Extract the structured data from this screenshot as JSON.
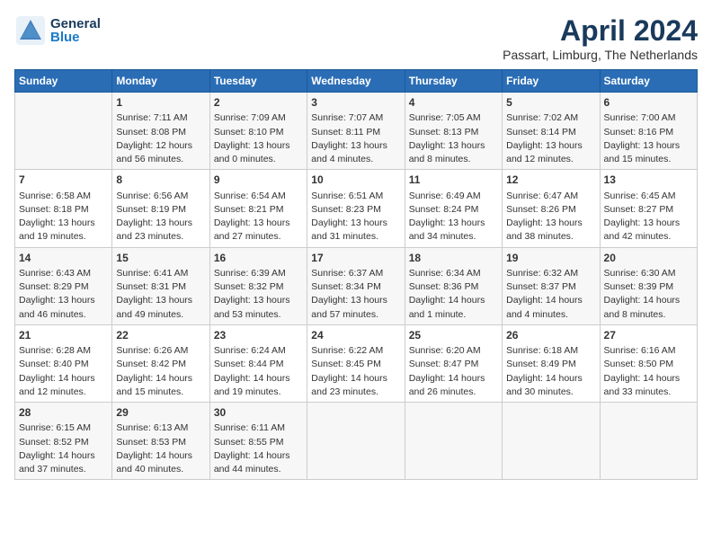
{
  "header": {
    "logo_general": "General",
    "logo_blue": "Blue",
    "month_year": "April 2024",
    "location": "Passart, Limburg, The Netherlands"
  },
  "days_of_week": [
    "Sunday",
    "Monday",
    "Tuesday",
    "Wednesday",
    "Thursday",
    "Friday",
    "Saturday"
  ],
  "weeks": [
    [
      {
        "day": "",
        "info": ""
      },
      {
        "day": "1",
        "info": "Sunrise: 7:11 AM\nSunset: 8:08 PM\nDaylight: 12 hours\nand 56 minutes."
      },
      {
        "day": "2",
        "info": "Sunrise: 7:09 AM\nSunset: 8:10 PM\nDaylight: 13 hours\nand 0 minutes."
      },
      {
        "day": "3",
        "info": "Sunrise: 7:07 AM\nSunset: 8:11 PM\nDaylight: 13 hours\nand 4 minutes."
      },
      {
        "day": "4",
        "info": "Sunrise: 7:05 AM\nSunset: 8:13 PM\nDaylight: 13 hours\nand 8 minutes."
      },
      {
        "day": "5",
        "info": "Sunrise: 7:02 AM\nSunset: 8:14 PM\nDaylight: 13 hours\nand 12 minutes."
      },
      {
        "day": "6",
        "info": "Sunrise: 7:00 AM\nSunset: 8:16 PM\nDaylight: 13 hours\nand 15 minutes."
      }
    ],
    [
      {
        "day": "7",
        "info": "Sunrise: 6:58 AM\nSunset: 8:18 PM\nDaylight: 13 hours\nand 19 minutes."
      },
      {
        "day": "8",
        "info": "Sunrise: 6:56 AM\nSunset: 8:19 PM\nDaylight: 13 hours\nand 23 minutes."
      },
      {
        "day": "9",
        "info": "Sunrise: 6:54 AM\nSunset: 8:21 PM\nDaylight: 13 hours\nand 27 minutes."
      },
      {
        "day": "10",
        "info": "Sunrise: 6:51 AM\nSunset: 8:23 PM\nDaylight: 13 hours\nand 31 minutes."
      },
      {
        "day": "11",
        "info": "Sunrise: 6:49 AM\nSunset: 8:24 PM\nDaylight: 13 hours\nand 34 minutes."
      },
      {
        "day": "12",
        "info": "Sunrise: 6:47 AM\nSunset: 8:26 PM\nDaylight: 13 hours\nand 38 minutes."
      },
      {
        "day": "13",
        "info": "Sunrise: 6:45 AM\nSunset: 8:27 PM\nDaylight: 13 hours\nand 42 minutes."
      }
    ],
    [
      {
        "day": "14",
        "info": "Sunrise: 6:43 AM\nSunset: 8:29 PM\nDaylight: 13 hours\nand 46 minutes."
      },
      {
        "day": "15",
        "info": "Sunrise: 6:41 AM\nSunset: 8:31 PM\nDaylight: 13 hours\nand 49 minutes."
      },
      {
        "day": "16",
        "info": "Sunrise: 6:39 AM\nSunset: 8:32 PM\nDaylight: 13 hours\nand 53 minutes."
      },
      {
        "day": "17",
        "info": "Sunrise: 6:37 AM\nSunset: 8:34 PM\nDaylight: 13 hours\nand 57 minutes."
      },
      {
        "day": "18",
        "info": "Sunrise: 6:34 AM\nSunset: 8:36 PM\nDaylight: 14 hours\nand 1 minute."
      },
      {
        "day": "19",
        "info": "Sunrise: 6:32 AM\nSunset: 8:37 PM\nDaylight: 14 hours\nand 4 minutes."
      },
      {
        "day": "20",
        "info": "Sunrise: 6:30 AM\nSunset: 8:39 PM\nDaylight: 14 hours\nand 8 minutes."
      }
    ],
    [
      {
        "day": "21",
        "info": "Sunrise: 6:28 AM\nSunset: 8:40 PM\nDaylight: 14 hours\nand 12 minutes."
      },
      {
        "day": "22",
        "info": "Sunrise: 6:26 AM\nSunset: 8:42 PM\nDaylight: 14 hours\nand 15 minutes."
      },
      {
        "day": "23",
        "info": "Sunrise: 6:24 AM\nSunset: 8:44 PM\nDaylight: 14 hours\nand 19 minutes."
      },
      {
        "day": "24",
        "info": "Sunrise: 6:22 AM\nSunset: 8:45 PM\nDaylight: 14 hours\nand 23 minutes."
      },
      {
        "day": "25",
        "info": "Sunrise: 6:20 AM\nSunset: 8:47 PM\nDaylight: 14 hours\nand 26 minutes."
      },
      {
        "day": "26",
        "info": "Sunrise: 6:18 AM\nSunset: 8:49 PM\nDaylight: 14 hours\nand 30 minutes."
      },
      {
        "day": "27",
        "info": "Sunrise: 6:16 AM\nSunset: 8:50 PM\nDaylight: 14 hours\nand 33 minutes."
      }
    ],
    [
      {
        "day": "28",
        "info": "Sunrise: 6:15 AM\nSunset: 8:52 PM\nDaylight: 14 hours\nand 37 minutes."
      },
      {
        "day": "29",
        "info": "Sunrise: 6:13 AM\nSunset: 8:53 PM\nDaylight: 14 hours\nand 40 minutes."
      },
      {
        "day": "30",
        "info": "Sunrise: 6:11 AM\nSunset: 8:55 PM\nDaylight: 14 hours\nand 44 minutes."
      },
      {
        "day": "",
        "info": ""
      },
      {
        "day": "",
        "info": ""
      },
      {
        "day": "",
        "info": ""
      },
      {
        "day": "",
        "info": ""
      }
    ]
  ]
}
